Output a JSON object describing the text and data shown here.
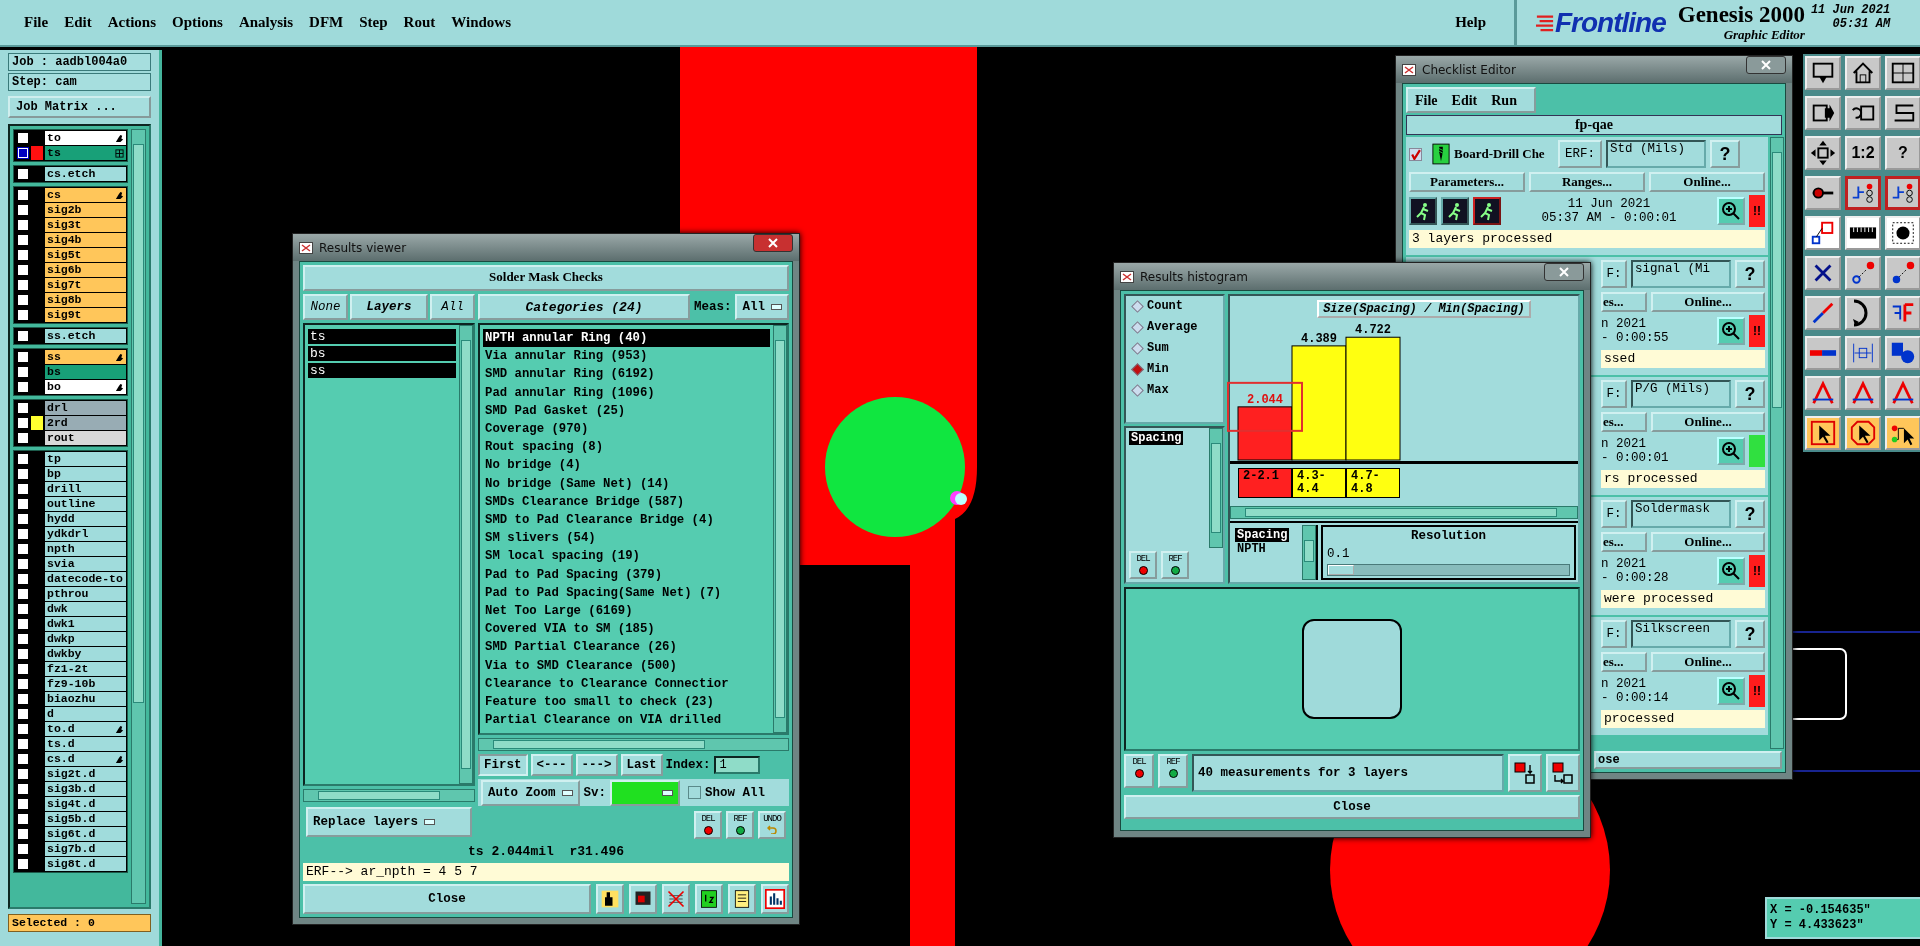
{
  "menu_bar": {
    "items": [
      "File",
      "Edit",
      "Actions",
      "Options",
      "Analysis",
      "DFM",
      "Step",
      "Rout",
      "Windows"
    ],
    "help": "Help",
    "brand": "Frontline",
    "product": "Genesis 2000",
    "subtitle": "Graphic Editor",
    "date": "11 Jun 2021",
    "time": "05:31 AM"
  },
  "layer_panel": {
    "job": "Job : aadbl004a0",
    "step": "Step: cam",
    "matrix_button": "Job Matrix ...",
    "selected_count": "Selected : 0",
    "groups": [
      {
        "layers": [
          {
            "name": "to",
            "color": "#ffffff",
            "edited": true,
            "work": false
          },
          {
            "name": "ts",
            "color": "#18a078",
            "swatch": {
              "color": "#ff1010"
            },
            "edited": false,
            "work": true
          }
        ]
      },
      {
        "layers": [
          {
            "name": "cs.etch",
            "color": "#a0dcdc",
            "edited": false,
            "work": false
          }
        ]
      },
      {
        "layers": [
          {
            "name": "cs",
            "color": "#ffc65a",
            "edited": true,
            "work": false
          },
          {
            "name": "sig2b",
            "color": "#ffc65a",
            "edited": false,
            "work": false
          },
          {
            "name": "sig3t",
            "color": "#ffc65a",
            "edited": false,
            "work": false
          },
          {
            "name": "sig4b",
            "color": "#ffc65a",
            "edited": false,
            "work": false
          },
          {
            "name": "sig5t",
            "color": "#ffc65a",
            "edited": false,
            "work": false
          },
          {
            "name": "sig6b",
            "color": "#ffc65a",
            "edited": false,
            "work": false
          },
          {
            "name": "sig7t",
            "color": "#ffc65a",
            "edited": false,
            "work": false
          },
          {
            "name": "sig8b",
            "color": "#ffc65a",
            "edited": false,
            "work": false
          },
          {
            "name": "sig9t",
            "color": "#ffc65a",
            "edited": false,
            "work": false
          }
        ]
      },
      {
        "layers": [
          {
            "name": "ss.etch",
            "color": "#a0dcdc",
            "edited": false,
            "work": false
          }
        ]
      },
      {
        "layers": [
          {
            "name": "ss",
            "color": "#ffc65a",
            "edited": true,
            "work": false
          },
          {
            "name": "bs",
            "color": "#18a078",
            "edited": false,
            "work": false
          },
          {
            "name": "bo",
            "color": "#ffffff",
            "edited": true,
            "work": false
          }
        ]
      },
      {
        "layers": [
          {
            "name": "drl",
            "color": "#98acb4",
            "edited": false,
            "work": false
          },
          {
            "name": "2rd",
            "color": "#98acb4",
            "swatch": {
              "color": "#ffff30"
            },
            "edited": false,
            "work": false
          },
          {
            "name": "rout",
            "color": "#d8d8d8",
            "edited": false,
            "work": false
          }
        ]
      },
      {
        "layers": [
          {
            "name": "tp",
            "color": "#a0dcdc",
            "edited": false,
            "work": false
          },
          {
            "name": "bp",
            "color": "#a0dcdc",
            "edited": false,
            "work": false
          },
          {
            "name": "drill",
            "color": "#a0dcdc",
            "edited": false,
            "work": false
          },
          {
            "name": "outline",
            "color": "#a0dcdc",
            "edited": false,
            "work": false
          },
          {
            "name": "hydd",
            "color": "#a0dcdc",
            "edited": false,
            "work": false
          },
          {
            "name": "ydkdrl",
            "color": "#a0dcdc",
            "edited": false,
            "work": false
          },
          {
            "name": "npth",
            "color": "#a0dcdc",
            "edited": false,
            "work": false
          },
          {
            "name": "svia",
            "color": "#a0dcdc",
            "edited": false,
            "work": false
          },
          {
            "name": "datecode-to",
            "color": "#a0dcdc",
            "edited": false,
            "work": false
          },
          {
            "name": "pthrou",
            "color": "#a0dcdc",
            "edited": false,
            "work": false
          },
          {
            "name": "dwk",
            "color": "#a0dcdc",
            "edited": false,
            "work": false
          },
          {
            "name": "dwk1",
            "color": "#a0dcdc",
            "edited": false,
            "work": false
          },
          {
            "name": "dwkp",
            "color": "#a0dcdc",
            "edited": false,
            "work": false
          },
          {
            "name": "dwkby",
            "color": "#a0dcdc",
            "edited": false,
            "work": false
          },
          {
            "name": "fz1-2t",
            "color": "#a0dcdc",
            "edited": false,
            "work": false
          },
          {
            "name": "fz9-10b",
            "color": "#a0dcdc",
            "edited": false,
            "work": false
          },
          {
            "name": "biaozhu",
            "color": "#a0dcdc",
            "edited": false,
            "work": false
          },
          {
            "name": "d",
            "color": "#a0dcdc",
            "edited": false,
            "work": false
          },
          {
            "name": "to.d",
            "color": "#a0dcdc",
            "edited": true,
            "work": false
          },
          {
            "name": "ts.d",
            "color": "#a0dcdc",
            "edited": false,
            "work": false
          },
          {
            "name": "cs.d",
            "color": "#a0dcdc",
            "edited": true,
            "work": false
          },
          {
            "name": "sig2t.d",
            "color": "#a0dcdc",
            "edited": false,
            "work": false
          },
          {
            "name": "sig3b.d",
            "color": "#a0dcdc",
            "edited": false,
            "work": false
          },
          {
            "name": "sig4t.d",
            "color": "#a0dcdc",
            "edited": false,
            "work": false
          },
          {
            "name": "sig5b.d",
            "color": "#a0dcdc",
            "edited": false,
            "work": false
          },
          {
            "name": "sig6t.d",
            "color": "#a0dcdc",
            "edited": false,
            "work": false
          },
          {
            "name": "sig7b.d",
            "color": "#a0dcdc",
            "edited": false,
            "work": false
          },
          {
            "name": "sig8t.d",
            "color": "#a0dcdc",
            "edited": false,
            "work": false
          }
        ]
      }
    ]
  },
  "results_viewer": {
    "title": "Results viewer",
    "heading": "Solder Mask Checks",
    "layer_buttons": [
      "None",
      "Layers",
      "All"
    ],
    "layers": [
      {
        "name": "ts",
        "selected": true
      },
      {
        "name": "bs",
        "selected": true
      },
      {
        "name": "ss",
        "selected": true
      }
    ],
    "categories_button": "Categories (24)",
    "meas_label": "Meas:",
    "meas_value": "All",
    "categories": [
      {
        "label": "NPTH annular Ring (40)",
        "selected": true
      },
      {
        "label": "Via annular Ring (953)",
        "selected": false
      },
      {
        "label": "SMD annular Ring (6192)",
        "selected": false
      },
      {
        "label": "Pad annular Ring (1096)",
        "selected": false
      },
      {
        "label": "SMD Pad Gasket (25)",
        "selected": false
      },
      {
        "label": "Coverage (970)",
        "selected": false
      },
      {
        "label": "Rout spacing (8)",
        "selected": false
      },
      {
        "label": "No bridge (4)",
        "selected": false
      },
      {
        "label": "No bridge (Same Net) (14)",
        "selected": false
      },
      {
        "label": "SMDs Clearance Bridge (587)",
        "selected": false
      },
      {
        "label": "SMD to Pad Clearance Bridge (4)",
        "selected": false
      },
      {
        "label": "SM slivers (54)",
        "selected": false
      },
      {
        "label": "SM local spacing (19)",
        "selected": false
      },
      {
        "label": "Pad to Pad Spacing (379)",
        "selected": false
      },
      {
        "label": "Pad to Pad Spacing(Same Net) (7)",
        "selected": false
      },
      {
        "label": "Net Too Large (6169)",
        "selected": false
      },
      {
        "label": "Covered VIA to SM (185)",
        "selected": false
      },
      {
        "label": "SMD Partial Clearance (26)",
        "selected": false
      },
      {
        "label": "Via to SMD Clearance (500)",
        "selected": false
      },
      {
        "label": "Clearance to Clearance Connectior",
        "selected": false
      },
      {
        "label": "Feature too small to check (23)",
        "selected": false
      },
      {
        "label": "Partial Clearance on VIA drilled",
        "selected": false
      }
    ],
    "nav": [
      "First",
      "<---",
      "--->",
      "Last"
    ],
    "index_label": "Index:",
    "index_value": "1",
    "zoom_mode": "Auto Zoom",
    "sv_label": "Sv:",
    "show_all": {
      "label": "Show All",
      "checked": false
    },
    "edit_buttons": [
      {
        "label": "DEL",
        "kind": "del"
      },
      {
        "label": "REF",
        "kind": "ref"
      },
      {
        "label": "UNDO",
        "kind": "undo"
      }
    ],
    "replace_mode": "Replace layers",
    "status": "ts 2.044mil  r31.496",
    "erf_line": "ERF--> ar_npth = 4 5 7",
    "close": "Close",
    "tools": [
      {
        "kind": "figure"
      },
      {
        "kind": "screen"
      },
      {
        "kind": "crossed"
      },
      {
        "kind": "numbers"
      },
      {
        "kind": "notes"
      },
      {
        "kind": "chart"
      }
    ]
  },
  "checklist_editor": {
    "title": "Checklist Editor",
    "menu": [
      "File",
      "Edit",
      "Run"
    ],
    "name": "fp-qae",
    "items": [
      {
        "kind": "full",
        "checked": true,
        "title": "Board-Drill Che",
        "erf_label": "ERF:",
        "erf": "Std (Mils)",
        "help": "?",
        "parameters": "Parameters...",
        "ranges": "Ranges...",
        "online": "Online...",
        "date": "11 Jun 2021",
        "time": "05:37 AM - 0:00:01",
        "message": "3 layers processed",
        "color": "#ff1c1c",
        "alert": "!!"
      },
      {
        "kind": "clipped",
        "erf_label": "F:",
        "erf": "signal (Mi",
        "help": "?",
        "ranges": "es...",
        "online": "Online...",
        "date": "n 2021",
        "time": "- 0:00:55",
        "message": "ssed",
        "color": "#ff1c1c",
        "alert": "!!"
      },
      {
        "kind": "clipped",
        "erf_label": "F:",
        "erf": "P/G (Mils)",
        "help": "?",
        "ranges": "es...",
        "online": "Online...",
        "date": "n 2021",
        "time": "- 0:00:01",
        "message": "rs processed",
        "color": "#30e040"
      },
      {
        "kind": "clipped",
        "erf_label": "F:",
        "erf": "Soldermask",
        "help": "?",
        "ranges": "es...",
        "online": "Online...",
        "date": "n 2021",
        "time": "- 0:00:28",
        "message": "were processed",
        "color": "#ff1c1c",
        "alert": "!!"
      },
      {
        "kind": "clipped",
        "erf_label": "F:",
        "erf": "Silkscreen",
        "help": "?",
        "ranges": "es...",
        "online": "Online...",
        "date": "n 2021",
        "time": "- 0:00:14",
        "message": "processed",
        "color": "#ff1c1c",
        "alert": "!!"
      }
    ],
    "close": "ose"
  },
  "histogram": {
    "title": "Results histogram",
    "modes": [
      {
        "label": "Count",
        "selected": false
      },
      {
        "label": "Average",
        "selected": false
      },
      {
        "label": "Sum",
        "selected": false
      },
      {
        "label": "Min",
        "selected": true
      },
      {
        "label": "Max",
        "selected": false
      }
    ],
    "list": [
      {
        "label": "Spacing",
        "selected": true
      }
    ],
    "edit_buttons": [
      "DEL",
      "REF"
    ],
    "chart_data": {
      "type": "bar",
      "title": "Size(Spacing) / Min(Spacing)",
      "categories": [
        "2-2.1",
        "4.3-4.4",
        "4.7-4.8"
      ],
      "series": [
        {
          "color": "#ff2020",
          "values": [
            2.044,
            null,
            null
          ]
        },
        {
          "color": "#ffff10",
          "values": [
            null,
            4.389,
            4.722
          ]
        }
      ],
      "data_labels": true
    },
    "highlight": {
      "on": true
    },
    "sub_list": [
      {
        "label": "Spacing",
        "selected": true
      },
      {
        "label": "NPTH",
        "selected": false
      }
    ],
    "resolution_label": "Resolution",
    "resolution_value": "0.1",
    "resolution": {
      "level": 0.0
    },
    "footer_buttons": [
      "DEL",
      "REF"
    ],
    "footer_text": "40 measurements for 3 layers",
    "close": "Close"
  },
  "toolbar": [
    {
      "kind": "monitor"
    },
    {
      "kind": "house"
    },
    {
      "kind": "layout"
    },
    {
      "kind": "export"
    },
    {
      "kind": "undo"
    },
    {
      "kind": "sline"
    },
    {
      "kind": "move"
    },
    {
      "kind": "text",
      "label": "1:2"
    },
    {
      "kind": "text",
      "label": "?"
    },
    {
      "kind": "probe"
    },
    {
      "kind": "netlist"
    },
    {
      "kind": "netlist"
    },
    {
      "kind": "shape"
    },
    {
      "kind": "ruler"
    },
    {
      "kind": "dot"
    },
    {
      "kind": "cross"
    },
    {
      "kind": "snap-open"
    },
    {
      "kind": "snap-filled"
    },
    {
      "kind": "diag"
    },
    {
      "kind": "arc"
    },
    {
      "kind": "bracket"
    },
    {
      "kind": "line"
    },
    {
      "kind": "dimension"
    },
    {
      "kind": "blocks"
    },
    {
      "kind": "arch"
    },
    {
      "kind": "arch"
    },
    {
      "kind": "arch"
    },
    {
      "kind": "pointer"
    },
    {
      "kind": "pointer-oct"
    },
    {
      "kind": "pointer-net"
    }
  ],
  "coordinates": [
    "X = -0.154635\"",
    "Y = 4.433623\""
  ]
}
